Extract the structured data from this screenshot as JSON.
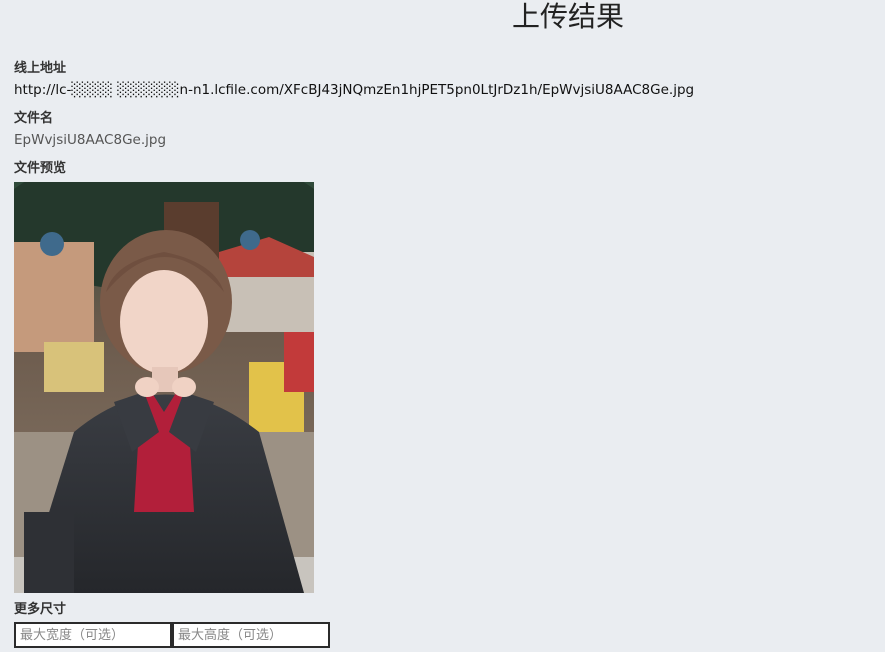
{
  "page": {
    "title": "上传结果"
  },
  "result": {
    "url_label": "线上地址",
    "url_value": "http://lc-░░░░ ░░░░░░n-n1.lcfile.com/XFcBJ43jNQmzEn1hjPET5pn0LtJrDz1h/EpWvjsiU8AAC8Ge.jpg",
    "filename_label": "文件名",
    "filename_value": "EpWvjsiU8AAC8Ge.jpg",
    "preview_label": "文件预览",
    "preview_alt": "uploaded photo preview"
  },
  "sizes": {
    "label": "更多尺寸",
    "max_width_placeholder": "最大宽度（可选）",
    "max_height_placeholder": "最大高度（可选）"
  },
  "colors": {
    "background": "#eaedf1",
    "input_border": "#2b2b2b"
  }
}
